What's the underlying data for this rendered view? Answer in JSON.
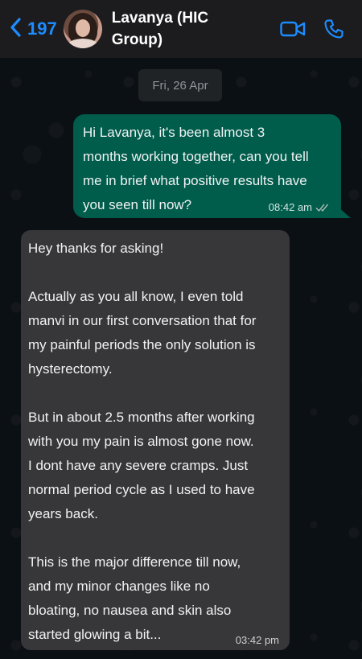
{
  "header": {
    "back_count": "197",
    "contact_name": "Lavanya (HIC Group)",
    "icons": {
      "back": "chevron-left-icon",
      "video": "video-call-icon",
      "phone": "phone-icon"
    },
    "accent_color": "#1d8cff"
  },
  "date_chip": "Fri, 26 Apr",
  "messages": [
    {
      "direction": "outgoing",
      "text": " Hi Lavanya, it's been almost 3\nmonths working together, can you tell\nme in brief what positive results have\nyou seen till now?",
      "time": "08:42 am",
      "status": "read-ticks-icon",
      "bubble_color": "#005c4b"
    },
    {
      "direction": "incoming",
      "text": " Hey thanks for asking!\n\nActually as you all know, I even told\nmanvi in our first conversation that for\nmy painful periods the only solution is\nhysterectomy.\n\nBut in about 2.5 months after working\nwith you my pain is almost gone now.\nI dont have any severe cramps. Just\nnormal period cycle as I used to have\nyears back.\n\nThis is the major difference till now,\nand my minor changes like no\nbloating, no nausea and skin also\nstarted glowing a bit...",
      "time": "03:42 pm",
      "bubble_color": "#373739"
    }
  ]
}
